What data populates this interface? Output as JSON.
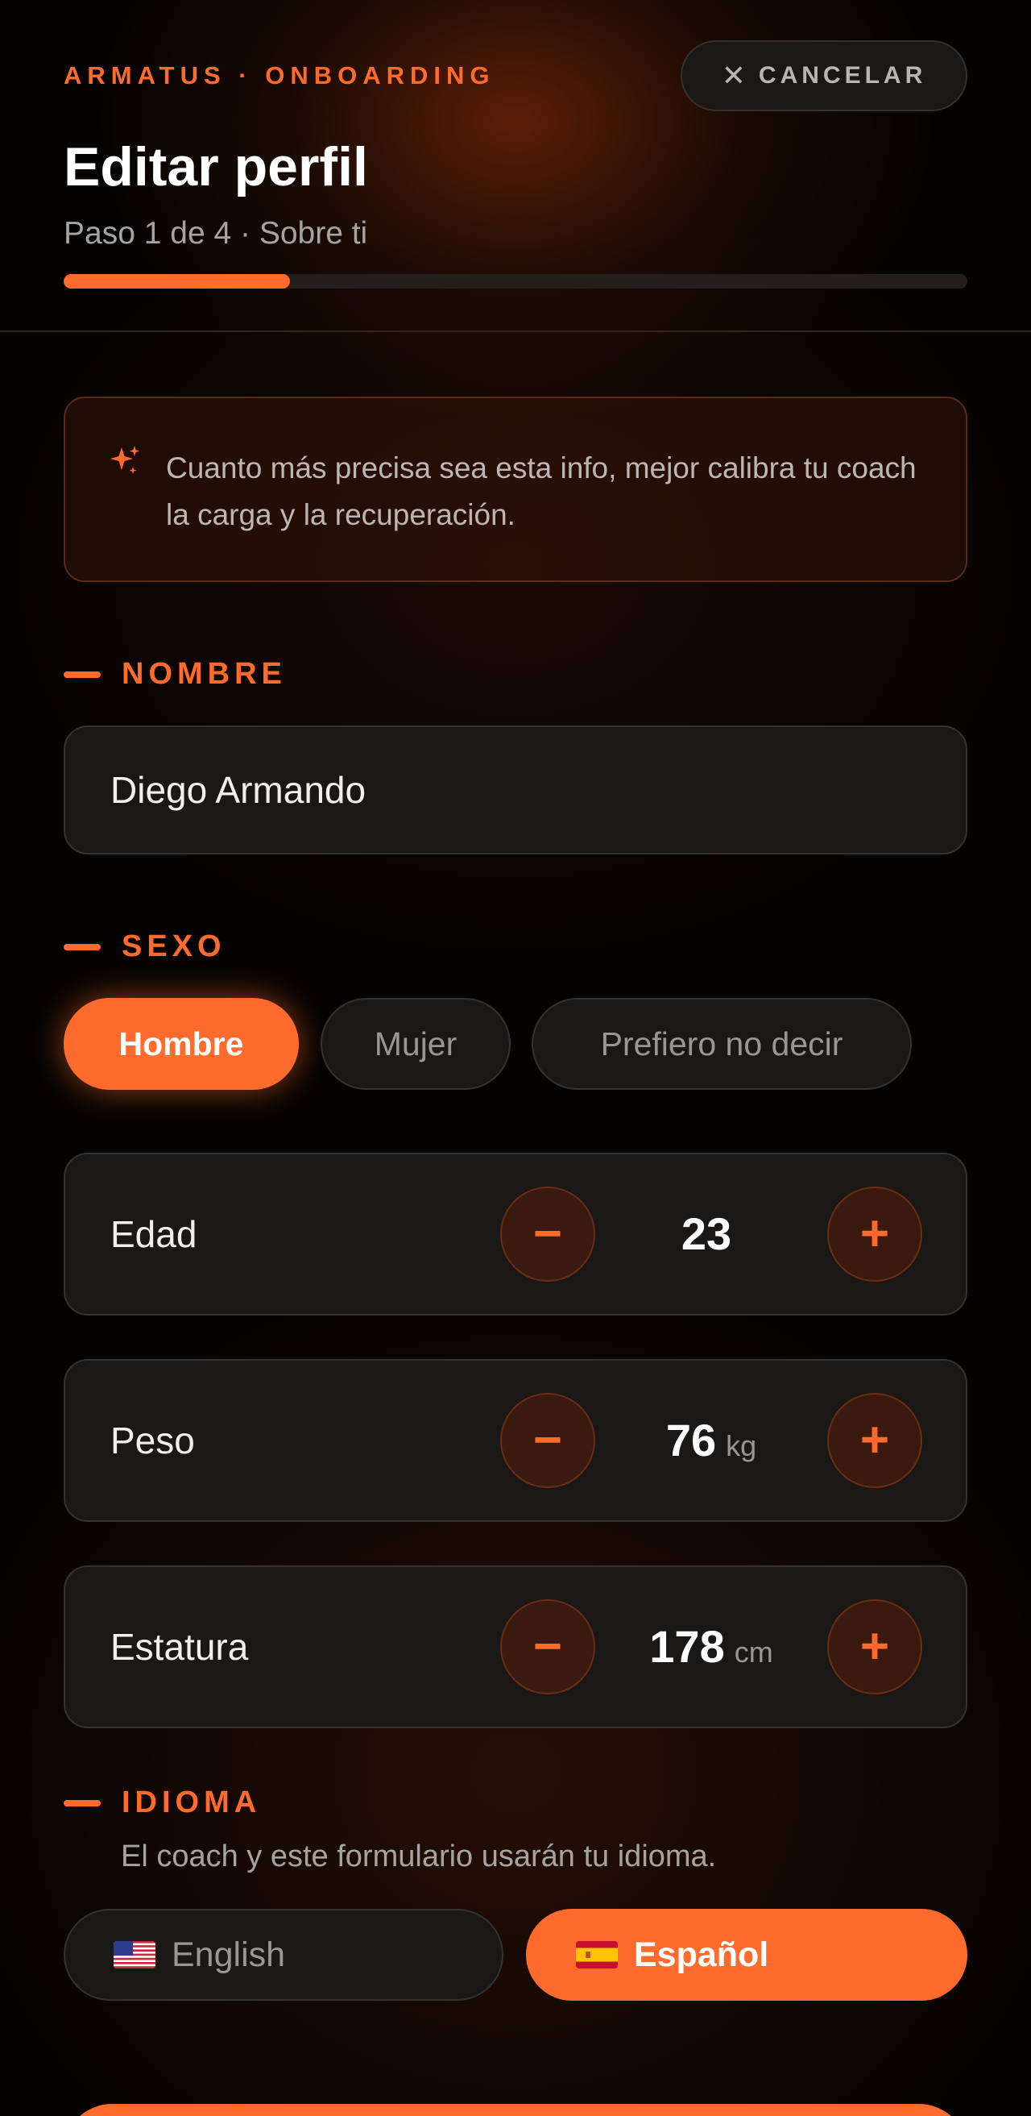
{
  "header": {
    "eyebrow": "ARMATUS · ONBOARDING",
    "cancel_label": "CANCELAR",
    "title": "Editar perfil",
    "subtitle": "Paso 1 de 4 · Sobre ti",
    "progress": {
      "current_step": 1,
      "total_steps": 4,
      "fraction": 0.25
    }
  },
  "tip": {
    "icon": "sparkles-icon",
    "text": "Cuanto más precisa sea esta info, mejor calibra tu coach la carga y la recuperación."
  },
  "name_section": {
    "label": "NOMBRE",
    "value": "Diego Armando"
  },
  "sex_section": {
    "label": "SEXO",
    "options": [
      {
        "label": "Hombre",
        "selected": true
      },
      {
        "label": "Mujer",
        "selected": false
      },
      {
        "label": "Prefiero no decir",
        "selected": false
      }
    ]
  },
  "metrics": [
    {
      "label": "Edad",
      "value": "23",
      "unit": ""
    },
    {
      "label": "Peso",
      "value": "76",
      "unit": "kg"
    },
    {
      "label": "Estatura",
      "value": "178",
      "unit": "cm"
    }
  ],
  "stepper_symbols": {
    "minus": "−",
    "plus": "+"
  },
  "language_section": {
    "label": "IDIOMA",
    "hint": "El coach y este formulario usarán tu idioma.",
    "options": [
      {
        "label": "English",
        "flag": "us-flag-icon",
        "selected": false
      },
      {
        "label": "Español",
        "flag": "es-flag-icon",
        "selected": true
      }
    ]
  },
  "colors": {
    "accent": "#ff6b2c",
    "background": "#050302",
    "card": "#1a1817",
    "muted_text": "#a7a3a0"
  }
}
